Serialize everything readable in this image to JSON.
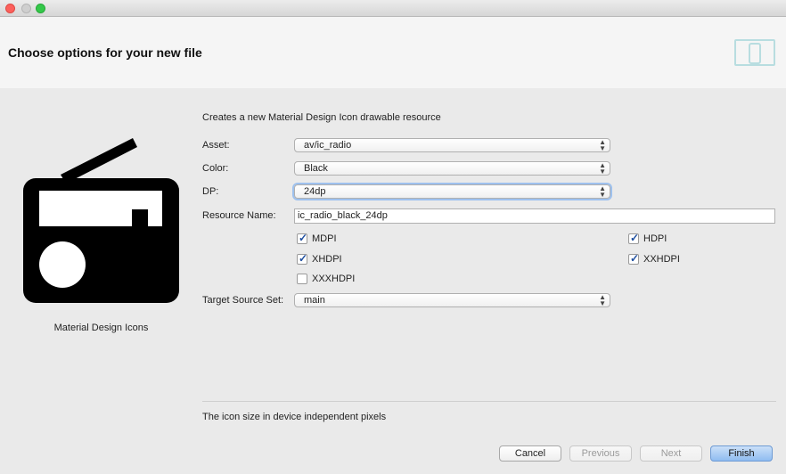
{
  "header": {
    "title": "Choose options for your new file"
  },
  "preview": {
    "label": "Material Design Icons"
  },
  "form": {
    "description": "Creates a new Material Design Icon drawable resource",
    "asset": {
      "label": "Asset:",
      "value": "av/ic_radio"
    },
    "color": {
      "label": "Color:",
      "value": "Black"
    },
    "dp": {
      "label": "DP:",
      "value": "24dp"
    },
    "resource_name": {
      "label": "Resource Name:",
      "value": "ic_radio_black_24dp"
    },
    "densities": [
      {
        "label": "MDPI",
        "checked": true
      },
      {
        "label": "HDPI",
        "checked": true
      },
      {
        "label": "XHDPI",
        "checked": true
      },
      {
        "label": "XXHDPI",
        "checked": true
      },
      {
        "label": "XXXHDPI",
        "checked": false
      }
    ],
    "target_source_set": {
      "label": "Target Source Set:",
      "value": "main"
    }
  },
  "hint": "The icon size in device independent pixels",
  "buttons": {
    "cancel": "Cancel",
    "previous": "Previous",
    "next": "Next",
    "finish": "Finish"
  },
  "icons": {
    "preview": "radio-icon",
    "header": "device-screens-icon"
  },
  "colors": {
    "accent": "#8fbcf1",
    "icon_fill": "#000000",
    "header_icon": "#b8dde0"
  }
}
